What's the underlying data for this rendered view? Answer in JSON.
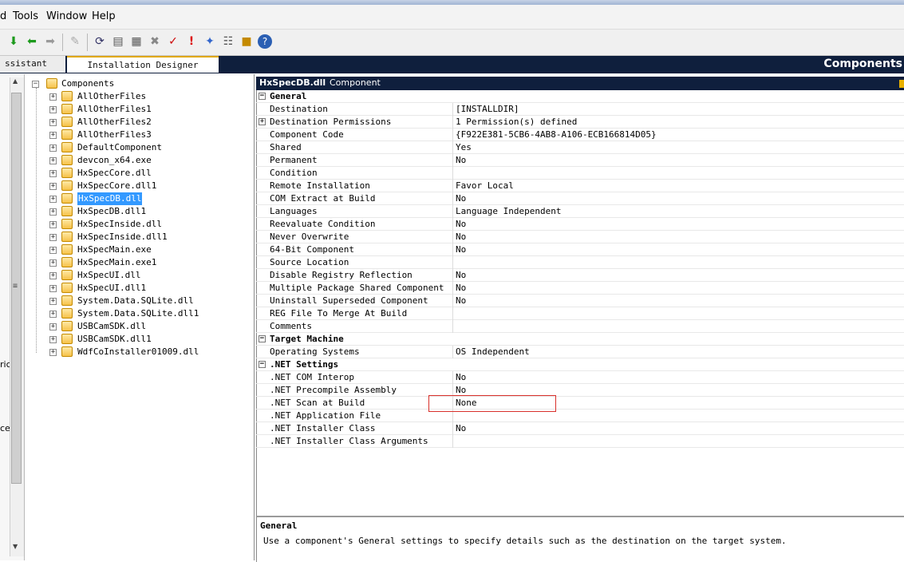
{
  "menu": [
    "d",
    "Tools",
    "Window",
    "Help"
  ],
  "toolbar_icons": [
    "arrow-down-icon",
    "arrow-left-icon",
    "arrow-right-icon",
    "disabled-action-icon",
    "sync-icon",
    "build-icon",
    "calendar-icon",
    "delete-icon",
    "validate-icon",
    "error-icon",
    "help-wizard-icon",
    "properties-icon",
    "package-icon",
    "help-icon"
  ],
  "tabs": {
    "assistant": "ssistant",
    "designer": "Installation Designer"
  },
  "view_title": "Components",
  "left_strip_labels": [
    "ric",
    "ce"
  ],
  "tree": {
    "root": "Components",
    "items": [
      "AllOtherFiles",
      "AllOtherFiles1",
      "AllOtherFiles2",
      "AllOtherFiles3",
      "DefaultComponent",
      "devcon_x64.exe",
      "HxSpecCore.dll",
      "HxSpecCore.dll1",
      "HxSpecDB.dll",
      "HxSpecDB.dll1",
      "HxSpecInside.dll",
      "HxSpecInside.dll1",
      "HxSpecMain.exe",
      "HxSpecMain.exe1",
      "HxSpecUI.dll",
      "HxSpecUI.dll1",
      "System.Data.SQLite.dll",
      "System.Data.SQLite.dll1",
      "USBCamSDK.dll",
      "USBCamSDK.dll1",
      "WdfCoInstaller01009.dll"
    ],
    "selected": "HxSpecDB.dll"
  },
  "grid_header": {
    "name": "HxSpecDB.dll",
    "type": "Component"
  },
  "properties": [
    {
      "kind": "cat",
      "name": "General"
    },
    {
      "name": "Destination",
      "value": "[INSTALLDIR]"
    },
    {
      "name": "Destination Permissions",
      "value": "1 Permission(s) defined",
      "expandable": true
    },
    {
      "name": "Component Code",
      "value": "{F922E381-5CB6-4AB8-A106-ECB166814D05}"
    },
    {
      "name": "Shared",
      "value": "Yes"
    },
    {
      "name": "Permanent",
      "value": "No"
    },
    {
      "name": "Condition",
      "value": ""
    },
    {
      "name": "Remote Installation",
      "value": "Favor Local"
    },
    {
      "name": "COM Extract at Build",
      "value": "No"
    },
    {
      "name": "Languages",
      "value": "Language Independent"
    },
    {
      "name": "Reevaluate Condition",
      "value": "No"
    },
    {
      "name": "Never Overwrite",
      "value": "No"
    },
    {
      "name": "64-Bit Component",
      "value": "No"
    },
    {
      "name": "Source Location",
      "value": ""
    },
    {
      "name": "Disable Registry Reflection",
      "value": "No"
    },
    {
      "name": "Multiple Package Shared Component",
      "value": "No"
    },
    {
      "name": "Uninstall Superseded Component",
      "value": "No"
    },
    {
      "name": "REG File To Merge At Build",
      "value": ""
    },
    {
      "name": "Comments",
      "value": ""
    },
    {
      "kind": "cat",
      "name": "Target Machine"
    },
    {
      "name": "Operating Systems",
      "value": "OS Independent"
    },
    {
      "kind": "cat",
      "name": ".NET Settings"
    },
    {
      "name": ".NET COM Interop",
      "value": "No"
    },
    {
      "name": ".NET Precompile Assembly",
      "value": "No"
    },
    {
      "name": ".NET Scan at Build",
      "value": "None"
    },
    {
      "name": ".NET Application File",
      "value": ""
    },
    {
      "name": ".NET Installer Class",
      "value": "No"
    },
    {
      "name": ".NET Installer Class Arguments",
      "value": ""
    }
  ],
  "description": {
    "title": "General",
    "text": "Use a component's General settings to specify details such as the destination on the target system."
  },
  "colors": {
    "title_band": "#0f1f3d",
    "selection": "#3399ff",
    "highlight": "#d9302b"
  }
}
